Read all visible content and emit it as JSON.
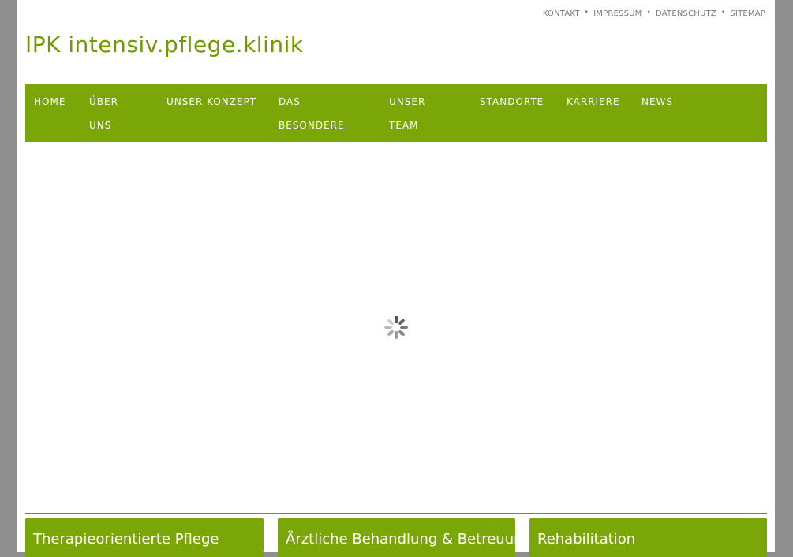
{
  "meta_nav": {
    "items": [
      "KONTAKT",
      "IMPRESSUM",
      "DATENSCHUTZ",
      "SITEMAP"
    ]
  },
  "brand": {
    "title": "IPK intensiv.pflege.klinik"
  },
  "main_nav": {
    "items": [
      {
        "label": "HOME"
      },
      {
        "label": "ÜBER UNS"
      },
      {
        "label": "UNSER KONZEPT"
      },
      {
        "label": "DAS BESONDERE"
      },
      {
        "label": "UNSER TEAM"
      },
      {
        "label": "STANDORTE"
      },
      {
        "label": "KARRIERE"
      },
      {
        "label": "NEWS"
      }
    ]
  },
  "content": {
    "loading_icon": "spinner-icon"
  },
  "feature_boxes": [
    {
      "title": "Therapieorientierte Pflege"
    },
    {
      "title": "Ärztliche Behandlung & Betreuung"
    },
    {
      "title": "Rehabilitation"
    }
  ],
  "colors": {
    "accent": "#7aa608",
    "brand_text": "#6f9b00",
    "outer_background": "#8f8f8f"
  }
}
